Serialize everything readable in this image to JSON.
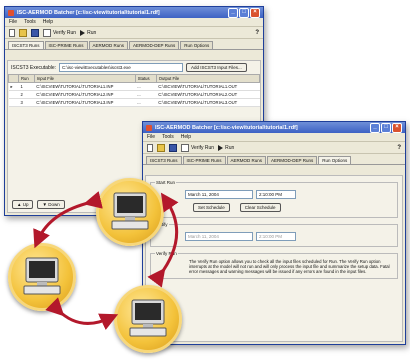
{
  "app": {
    "title": "ISC-AERMOD Batcher [c:\\isc-view\\tutorial\\tutorial1.rdf]",
    "menu": [
      "File",
      "Tools",
      "Help"
    ],
    "toolbar": {
      "verify_run": "Verify Run",
      "run": "Run",
      "help": "?"
    },
    "tabs": [
      "ISCST3 Runs",
      "ISC-PRIME Runs",
      "AERMOD Runs",
      "AERMOD-DEP Runs",
      "Run Options"
    ]
  },
  "back_window": {
    "exe_label": "ISCST3 Executable:",
    "exe_path": "C:\\isc-view\\Executables\\iscst3.exe",
    "add_button": "Add ISCST3 Input Files...",
    "columns": [
      "Run",
      "Input File",
      "Status",
      "Output File"
    ],
    "rows": [
      {
        "run": "1",
        "input": "C:\\ISCVIEW\\TUTORIAL\\TUTORIAL1.INP",
        "status": "...",
        "output": "C:\\ISCVIEW\\TUTORIAL\\TUTORIAL1.OUT"
      },
      {
        "run": "2",
        "input": "C:\\ISCVIEW\\TUTORIAL\\TUTORIAL2.INP",
        "status": "...",
        "output": "C:\\ISCVIEW\\TUTORIAL\\TUTORIAL2.OUT"
      },
      {
        "run": "3",
        "input": "C:\\ISCVIEW\\TUTORIAL\\TUTORIAL3.INP",
        "status": "...",
        "output": "C:\\ISCVIEW\\TUTORIAL\\TUTORIAL3.OUT"
      }
    ],
    "bottom_buttons": [
      "Up",
      "Down"
    ]
  },
  "front_window": {
    "active_tab": "Run Options",
    "start_run": {
      "label": "Start Run",
      "date": "March 11, 2004",
      "time": "2:10:00 PM",
      "set_button": "Set Schedule",
      "clear_button": "Clear Schedule"
    },
    "notify": {
      "label": "Notify",
      "date": "March 11, 2004",
      "time": "2:10:00 PM"
    },
    "verify_run": {
      "label": "Verify Run",
      "text": "The Verify Run option allows you to check all the input files scheduled for Run. The Verify Run option interrupts at the model will not run and will only process the input file and summarize the setup data. Fatal error messages and warning messages will be issued if any errors are found in the input files."
    }
  },
  "colors": {
    "title_bar": "#3d62c4",
    "window_bg": "#ece9d8",
    "badge": "#f3c23a",
    "arrow": "#b3182b"
  }
}
